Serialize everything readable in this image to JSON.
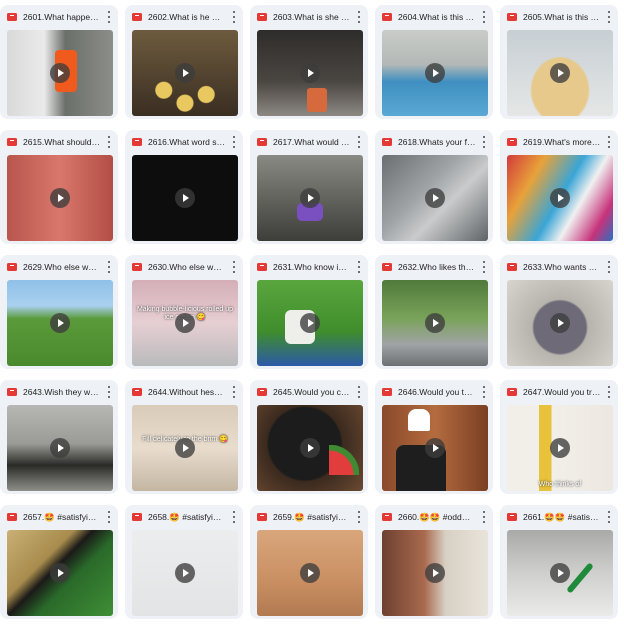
{
  "cards": [
    {
      "title": "2601.What happe…"
    },
    {
      "title": "2602.What is he …"
    },
    {
      "title": "2603.What is she …"
    },
    {
      "title": "2604.What is this …"
    },
    {
      "title": "2605.What is this …"
    },
    {
      "title": "2615.What should…"
    },
    {
      "title": "2616.What word s…"
    },
    {
      "title": "2617.What would …"
    },
    {
      "title": "2618.Whats your f…"
    },
    {
      "title": "2619.What's more …"
    },
    {
      "title": "2629.Who else wa…"
    },
    {
      "title": "2630.Who else w…"
    },
    {
      "title": "2631.Who know in…"
    },
    {
      "title": "2632.Who likes th…"
    },
    {
      "title": "2633.Who wants …"
    },
    {
      "title": "2643.Wish they w…"
    },
    {
      "title": "2644.Without hes…"
    },
    {
      "title": "2645.Would you c…"
    },
    {
      "title": "2646.Would you t…"
    },
    {
      "title": "2647.Would you tr…"
    },
    {
      "title": "2657.🤩 #satisfyi…"
    },
    {
      "title": "2658.🤩 #satisfyi…"
    },
    {
      "title": "2659.🤩 #satisfyi…"
    },
    {
      "title": "2660.🤩🤩 #odd…"
    },
    {
      "title": "2661.🤩🤩 #satis…"
    }
  ],
  "captions": {
    "c11": "Making bubble-licious rolled up ice cream 😋",
    "c16": "Fill delicately to the brim 😋",
    "c19": "Who thinks of"
  },
  "icons": {
    "file": "video-file-icon",
    "menu": "more-vert-icon",
    "play": "play-icon"
  },
  "colors": {
    "card_bg": "#eef1f6",
    "video_icon": "#e53935"
  }
}
